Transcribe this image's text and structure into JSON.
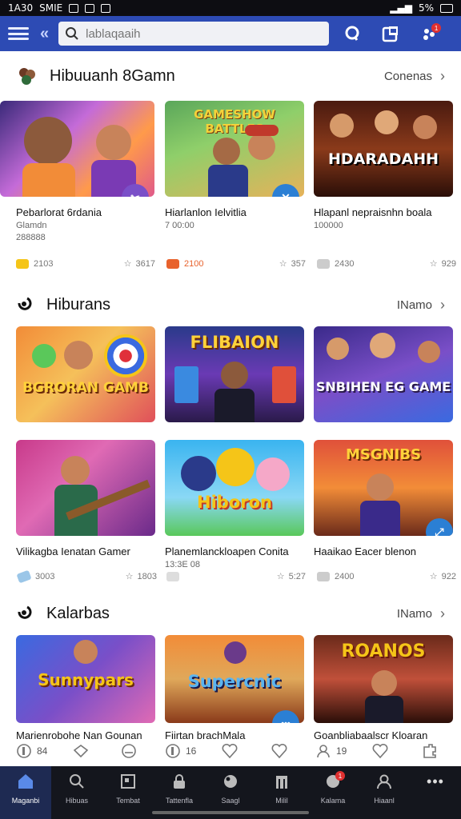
{
  "status": {
    "time": "1A30",
    "carrier": "SMIE",
    "right": "5%"
  },
  "search": {
    "placeholder": "lablaqaaih"
  },
  "colors": {
    "brand": "#2d4bb4",
    "nav_bg": "#14161d"
  },
  "sections": [
    {
      "title": "Hibuuanh 8Gamn",
      "more": "Conenas",
      "cards": [
        {
          "name": "Pebarlorat 6rdania",
          "sub1": "Glamdn",
          "sub2": "288888",
          "chip_color": "#f5c518",
          "chip_text": "2103",
          "rating": "3617",
          "art": "",
          "fab_icon": "wand-icon",
          "fab_color": "#7a4fc8"
        },
        {
          "name": "Hiarlanlon Ielvitlia",
          "sub1": "7 00:00",
          "sub2": "",
          "chip_color": "#e8622c",
          "chip_text": "2100",
          "rating": "357",
          "art": "GAMESHOW BATTLES",
          "fab_icon": "close-icon",
          "fab_color": "#2b7fd4"
        },
        {
          "name": "Hlapanl nepraisnhn boala",
          "sub1": "100000",
          "sub2": "",
          "chip_color": "#cccccc",
          "chip_text": "2430",
          "rating": "929",
          "art": "HDARADAHH",
          "fab_icon": "",
          "fab_color": ""
        }
      ]
    },
    {
      "title": "Hiburans",
      "more": "INamo",
      "cards": [
        {
          "name": "",
          "sub1": "",
          "sub2": "",
          "chip_color": "",
          "chip_text": "",
          "rating": "",
          "art": "BGRORAN GAMB",
          "fab_icon": "",
          "fab_color": ""
        },
        {
          "name": "",
          "sub1": "",
          "sub2": "",
          "chip_color": "",
          "chip_text": "",
          "rating": "",
          "art": "FLIBAION",
          "fab_icon": "",
          "fab_color": ""
        },
        {
          "name": "",
          "sub1": "",
          "sub2": "",
          "chip_color": "",
          "chip_text": "",
          "rating": "",
          "art": "SNBIHEN EG GAME",
          "fab_icon": "",
          "fab_color": ""
        },
        {
          "name": "Vilikagba Ienatan Gamer",
          "sub1": "",
          "sub2": "",
          "chip_color": "#9bc6e8",
          "chip_text": "3003",
          "rating": "1803",
          "art": "",
          "fab_icon": "",
          "fab_color": ""
        },
        {
          "name": "Planemlanckloapen Conita",
          "sub1": "13:3E 08",
          "sub2": "",
          "chip_color": "#dddddd",
          "chip_text": "",
          "rating": "5:27",
          "art": "Hiboron",
          "fab_icon": "",
          "fab_color": ""
        },
        {
          "name": "Haaikao Eacer blenon",
          "sub1": "",
          "sub2": "",
          "chip_color": "#cccccc",
          "chip_text": "2400",
          "rating": "922",
          "art": "MSGNIBS",
          "fab_icon": "expand-icon",
          "fab_color": "#2b7fd4"
        }
      ]
    },
    {
      "title": "Kalarbas",
      "more": "INamo",
      "cards": [
        {
          "name": "Marienrobohe Nan Gounan",
          "art": "Sunnypars"
        },
        {
          "name": "Fiirtan brachMala",
          "art": "Supercnic",
          "fab_icon": "more-icon",
          "fab_color": "#2b7fd4"
        },
        {
          "name": "Goanbliabaalscr Kloaran",
          "art": "ROANOS"
        }
      ]
    }
  ],
  "actions": [
    {
      "icon": "info-icon",
      "text": "84"
    },
    {
      "icon": "pin-icon",
      "text": ""
    },
    {
      "icon": "hand-icon",
      "text": ""
    },
    {
      "icon": "info-icon",
      "text": "16"
    },
    {
      "icon": "heart-icon",
      "text": ""
    },
    {
      "icon": "heart-icon",
      "text": ""
    },
    {
      "icon": "user-icon",
      "text": "19"
    },
    {
      "icon": "heart-icon",
      "text": ""
    },
    {
      "icon": "puzzle-icon",
      "text": ""
    }
  ],
  "nav": [
    {
      "icon": "home-icon",
      "label": "Maganbi",
      "active": true
    },
    {
      "icon": "search-icon",
      "label": "Hibuas"
    },
    {
      "icon": "screen-icon",
      "label": "Tembat"
    },
    {
      "icon": "lock-icon",
      "label": "Tattenfla"
    },
    {
      "icon": "ball-icon",
      "label": "Saagl"
    },
    {
      "icon": "building-icon",
      "label": "Milil"
    },
    {
      "icon": "notification-icon",
      "label": "Kalama"
    },
    {
      "icon": "user-icon",
      "label": "Hiaanl"
    },
    {
      "icon": "more-icon",
      "label": ""
    }
  ]
}
